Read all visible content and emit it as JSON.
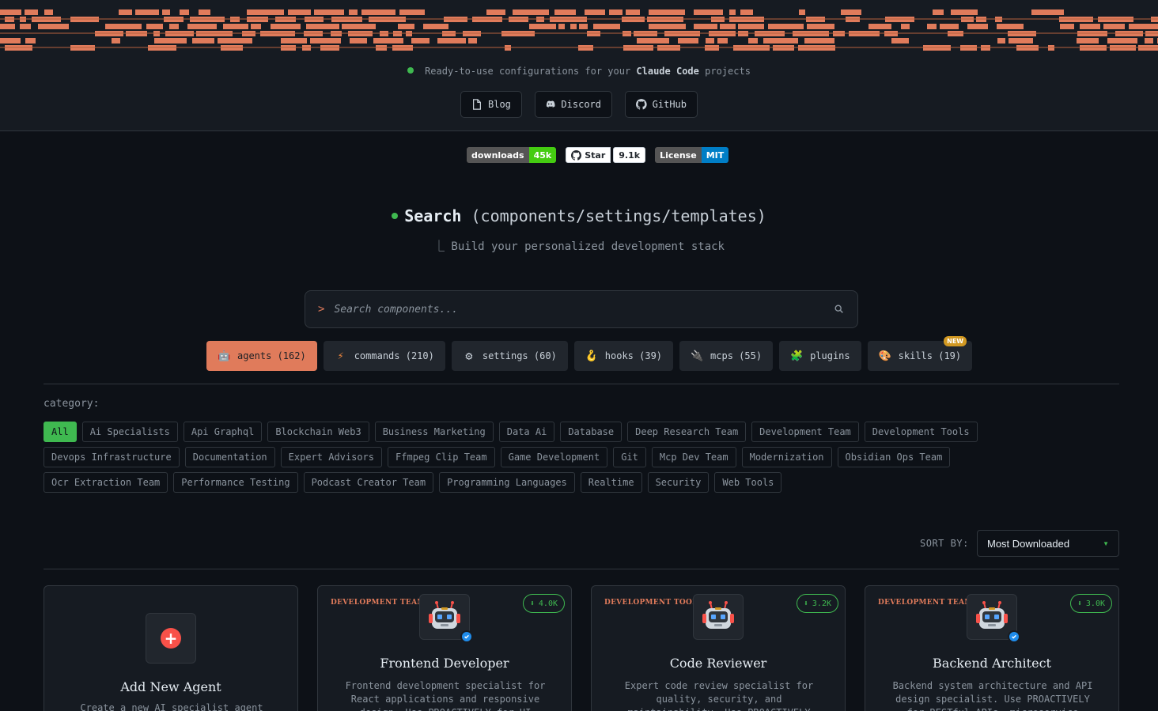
{
  "header": {
    "tagline_prefix": "Ready-to-use configurations for your",
    "tagline_brand": "Claude Code",
    "tagline_suffix": "projects",
    "links": [
      {
        "label": "Blog",
        "icon": "file-icon"
      },
      {
        "label": "Discord",
        "icon": "discord-icon"
      },
      {
        "label": "GitHub",
        "icon": "github-icon"
      }
    ]
  },
  "badges": {
    "downloads_label": "downloads",
    "downloads_value": "45k",
    "star_label": "Star",
    "star_count": "9.1k",
    "license_label": "License",
    "license_value": "MIT"
  },
  "search": {
    "title_bold": "Search",
    "title_rest": "(components/settings/templates)",
    "subtitle": "⎿ Build your personalized development stack",
    "prompt": ">",
    "placeholder": "Search components..."
  },
  "type_tabs": [
    {
      "label": "agents (162)",
      "icon": "robot-icon",
      "glyph": "🤖",
      "active": true
    },
    {
      "label": "commands (210)",
      "icon": "lightning-icon",
      "glyph": "⚡"
    },
    {
      "label": "settings (60)",
      "icon": "gear-icon",
      "glyph": "⚙"
    },
    {
      "label": "hooks (39)",
      "icon": "hook-icon",
      "glyph": "🪝"
    },
    {
      "label": "mcps (55)",
      "icon": "plug-icon",
      "glyph": "🔌"
    },
    {
      "label": "plugins",
      "icon": "puzzle-icon",
      "glyph": "🧩"
    },
    {
      "label": "skills (19)",
      "icon": "palette-icon",
      "glyph": "🎨",
      "badge": "NEW"
    }
  ],
  "categories": {
    "label": "category:",
    "items": [
      "All",
      "Ai Specialists",
      "Api Graphql",
      "Blockchain Web3",
      "Business Marketing",
      "Data Ai",
      "Database",
      "Deep Research Team",
      "Development Team",
      "Development Tools",
      "Devops Infrastructure",
      "Documentation",
      "Expert Advisors",
      "Ffmpeg Clip Team",
      "Game Development",
      "Git",
      "Mcp Dev Team",
      "Modernization",
      "Obsidian Ops Team",
      "Ocr Extraction Team",
      "Performance Testing",
      "Podcast Creator Team",
      "Programming Languages",
      "Realtime",
      "Security",
      "Web Tools"
    ]
  },
  "sort": {
    "label": "SORT BY:",
    "selected": "Most Downloaded"
  },
  "add_card": {
    "title": "Add New Agent",
    "desc": "Create a new AI specialist agent"
  },
  "cards": [
    {
      "category": "DEVELOPMENT TEAM",
      "downloads": "4.0K",
      "title": "Frontend Developer",
      "desc": "Frontend development specialist for React applications and responsive design. Use PROACTIVELY for UI",
      "verified": true
    },
    {
      "category": "DEVELOPMENT TOOLS",
      "downloads": "3.2K",
      "title": "Code Reviewer",
      "desc": "Expert code review specialist for quality, security, and maintainability. Use PROACTIVELY after",
      "verified": false
    },
    {
      "category": "DEVELOPMENT TEAM",
      "downloads": "3.0K",
      "title": "Backend Architect",
      "desc": "Backend system architecture and API design specialist. Use PROACTIVELY for RESTful APIs, microservice boundaries",
      "verified": true
    }
  ],
  "colors": {
    "accent": "#e07b5b",
    "green": "#3fb950",
    "background": "#0d1117",
    "panel": "#161b22"
  }
}
